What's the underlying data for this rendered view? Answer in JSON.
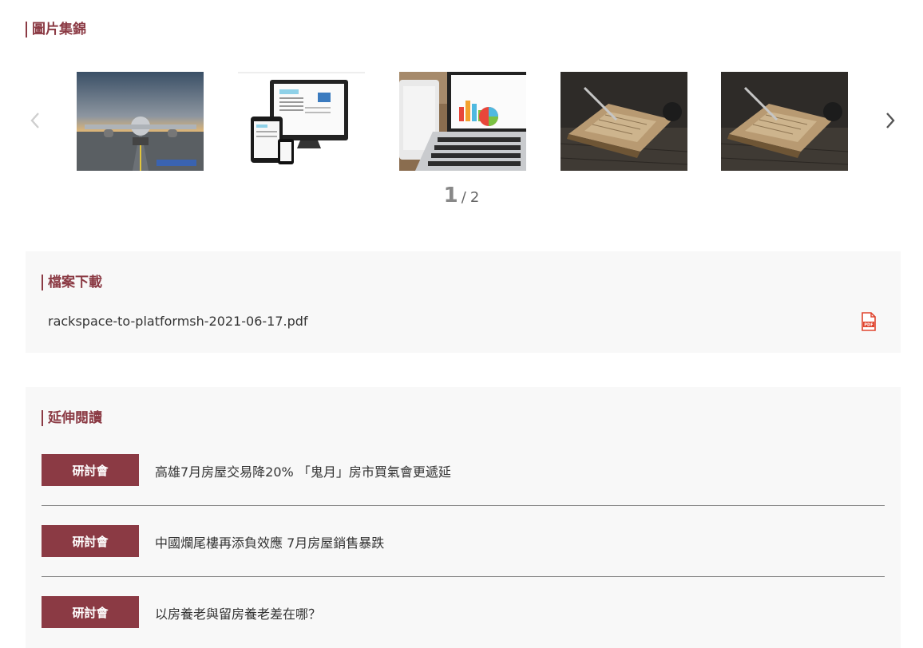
{
  "gallery": {
    "title": "圖片集錦",
    "prev_icon": "chevron-left-icon",
    "next_icon": "chevron-right-icon",
    "pager": {
      "current": "1",
      "separator": "/",
      "total": "2"
    },
    "thumbnails": [
      {
        "subject": "airplane"
      },
      {
        "subject": "devices"
      },
      {
        "subject": "laptop-chart"
      },
      {
        "subject": "book-pen"
      },
      {
        "subject": "book-pen"
      }
    ]
  },
  "download": {
    "title": "檔案下載",
    "file_name": "rackspace-to-platformsh-2021-06-17.pdf",
    "file_icon": "pdf-icon"
  },
  "related": {
    "title": "延伸閱讀",
    "items": [
      {
        "tag": "研討會",
        "title": "高雄7月房屋交易降20% 「鬼月」房市買氣會更遞延"
      },
      {
        "tag": "研討會",
        "title": "中國爛尾樓再添負效應 7月房屋銷售暴跌"
      },
      {
        "tag": "研討會",
        "title": "以房養老與留房養老差在哪？"
      }
    ]
  },
  "colors": {
    "accent": "#8b3a44",
    "panel_bg": "#f8f8f8",
    "pdf_red": "#e0452f"
  }
}
